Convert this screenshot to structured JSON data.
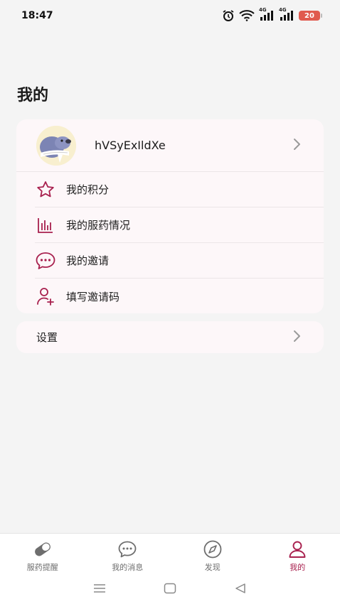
{
  "status_bar": {
    "time": "18:47",
    "battery": "20",
    "network_1": "4G",
    "network_2": "4G"
  },
  "page": {
    "title": "我的"
  },
  "profile": {
    "username": "hVSyExIldXe"
  },
  "menu": {
    "items": [
      {
        "label": "我的积分",
        "icon": "star-icon"
      },
      {
        "label": "我的服药情况",
        "icon": "bar-chart-icon"
      },
      {
        "label": "我的邀请",
        "icon": "chat-bubble-icon"
      },
      {
        "label": "填写邀请码",
        "icon": "add-user-icon"
      }
    ]
  },
  "settings": {
    "label": "设置"
  },
  "bottom_nav": {
    "items": [
      {
        "label": "服药提醒",
        "icon": "pill-icon",
        "active": false
      },
      {
        "label": "我的消息",
        "icon": "message-icon",
        "active": false
      },
      {
        "label": "发现",
        "icon": "compass-icon",
        "active": false
      },
      {
        "label": "我的",
        "icon": "person-icon",
        "active": true
      }
    ]
  },
  "colors": {
    "accent": "#a8204e",
    "card_bg": "#fdf7f9",
    "page_bg": "#f4f4f4"
  }
}
